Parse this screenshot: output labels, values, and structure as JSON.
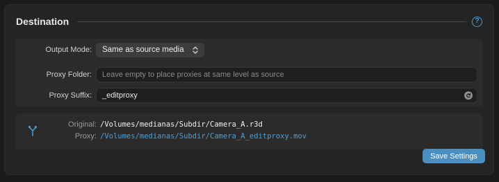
{
  "section": {
    "title": "Destination",
    "help_icon": "question-circle-icon",
    "help_glyph": "?"
  },
  "settings": {
    "output_mode": {
      "label": "Output Mode:",
      "value": "Same as source media"
    },
    "proxy_folder": {
      "label": "Proxy Folder:",
      "value": "",
      "placeholder": "Leave empty to place proxies at same level as source"
    },
    "proxy_suffix": {
      "label": "Proxy Suffix:",
      "value": "_editproxy",
      "reset_icon": "reset-icon"
    }
  },
  "preview": {
    "icon": "branch-icon",
    "original_label": "Original:",
    "original_path": "/Volumes/medianas/Subdir/Camera_A.r3d",
    "proxy_label": "Proxy:",
    "proxy_path": "/Volumes/medianas/Subdir/Camera_A_editproxy.mov"
  },
  "actions": {
    "save_label": "Save Settings"
  },
  "colors": {
    "accent": "#4a9bd1",
    "button": "#4a8fc0",
    "proxy_path": "#4d9fd6",
    "original_path": "#f0f0f0"
  }
}
